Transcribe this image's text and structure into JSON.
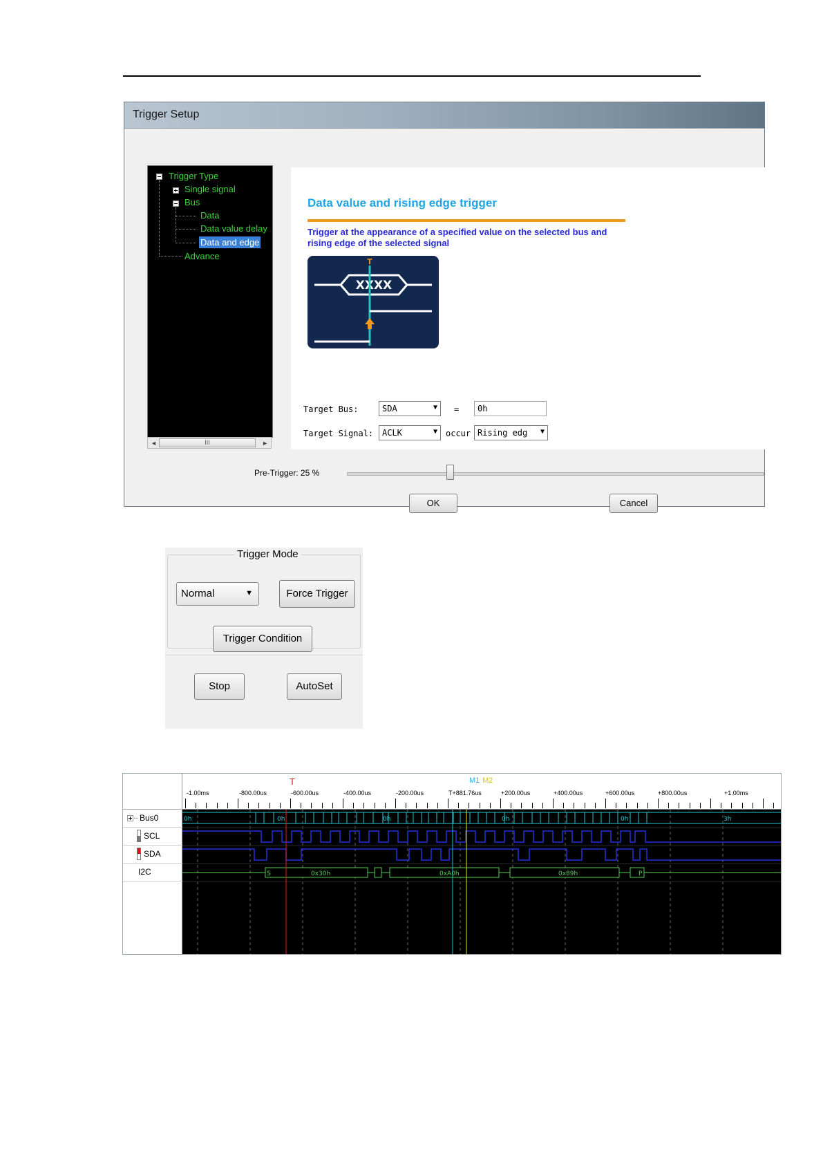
{
  "dialog": {
    "title": "Trigger Setup",
    "tree": {
      "root": "Trigger Type",
      "single_signal": "Single signal",
      "bus": "Bus",
      "data": "Data",
      "data_value_delay": "Data value delay",
      "data_and_edge": "Data and edge",
      "advance": "Advance",
      "scroll_thumb": "III"
    },
    "content": {
      "heading": "Data value and rising edge trigger",
      "description": "Trigger at the appearance of a specified value on the selected bus and rising edge of the selected signal",
      "diagram_t": "T",
      "diagram_value": "XXXX"
    },
    "form": {
      "target_bus_label": "Target Bus:",
      "target_bus_value": "SDA",
      "equals": "=",
      "value": "0h",
      "target_signal_label": "Target Signal:",
      "target_signal_value": "ACLK",
      "occur": "occur",
      "edge_value": "Rising edg"
    },
    "pretrigger_label": "Pre-Trigger: 25 %",
    "pretrigger_percent": 25,
    "ok": "OK",
    "cancel": "Cancel"
  },
  "trigger_mode": {
    "legend": "Trigger Mode",
    "mode_value": "Normal",
    "force_trigger": "Force Trigger",
    "trigger_condition": "Trigger Condition",
    "stop": "Stop",
    "autoset": "AutoSet"
  },
  "waveform": {
    "channels": [
      "Bus0",
      "SCL",
      "SDA",
      "I2C"
    ],
    "ticks": [
      "-1.00ms",
      "-800.00us",
      "-600.00us",
      "-400.00us",
      "-200.00us",
      "T+881.76us",
      "+200.00us",
      "+400.00us",
      "+600.00us",
      "+800.00us",
      "+1.00ms"
    ],
    "marker_t": "T",
    "marker_m1": "M1",
    "marker_m2": "M2",
    "bus_values": [
      "0h",
      "0h",
      "0h",
      "0h",
      "0h",
      "3h"
    ],
    "i2c_labels": [
      "S",
      "0x30h",
      "0xA0h",
      "0x89h",
      "P"
    ],
    "colors": {
      "bus": "#28c8d8",
      "clock": "#2233dd",
      "i2c": "#56d056",
      "trigger": "#e02020",
      "m1": "#26c0e0",
      "m2": "#e8e830"
    }
  }
}
